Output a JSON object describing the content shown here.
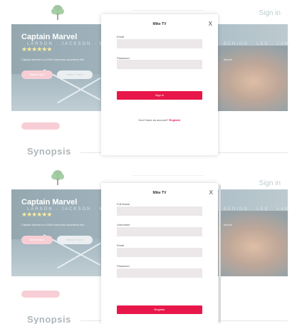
{
  "background": {
    "sign_in_label": "Sign in",
    "movie_title": "Captain Marvel",
    "cast_left": "LARSON · JACKSON · MEND",
    "cast_right": "BENING · LEE · LAW",
    "stars": "★★★★★★",
    "description_left": "Captain Marvel is a 2019 American superhero film",
    "description_right": "Marvel",
    "watch_button": "Watch Now",
    "trailer_button": "Watch Trailer",
    "synopsis_heading": "Synopsis",
    "colors": {
      "accent": "#e8174a",
      "hero_dark": "#3f6170"
    }
  },
  "login_modal": {
    "title": "Mike TV",
    "close_label": "X",
    "email_label": "Email",
    "password_label": "Password",
    "submit_label": "Sign in",
    "register_prompt": "Don't have an account?",
    "register_link": "Register"
  },
  "register_modal": {
    "title": "Mike TV",
    "close_label": "X",
    "fullname_label": "Full Name",
    "username_label": "Username",
    "email_label": "Email",
    "password_label": "Password",
    "submit_label": "Register"
  }
}
